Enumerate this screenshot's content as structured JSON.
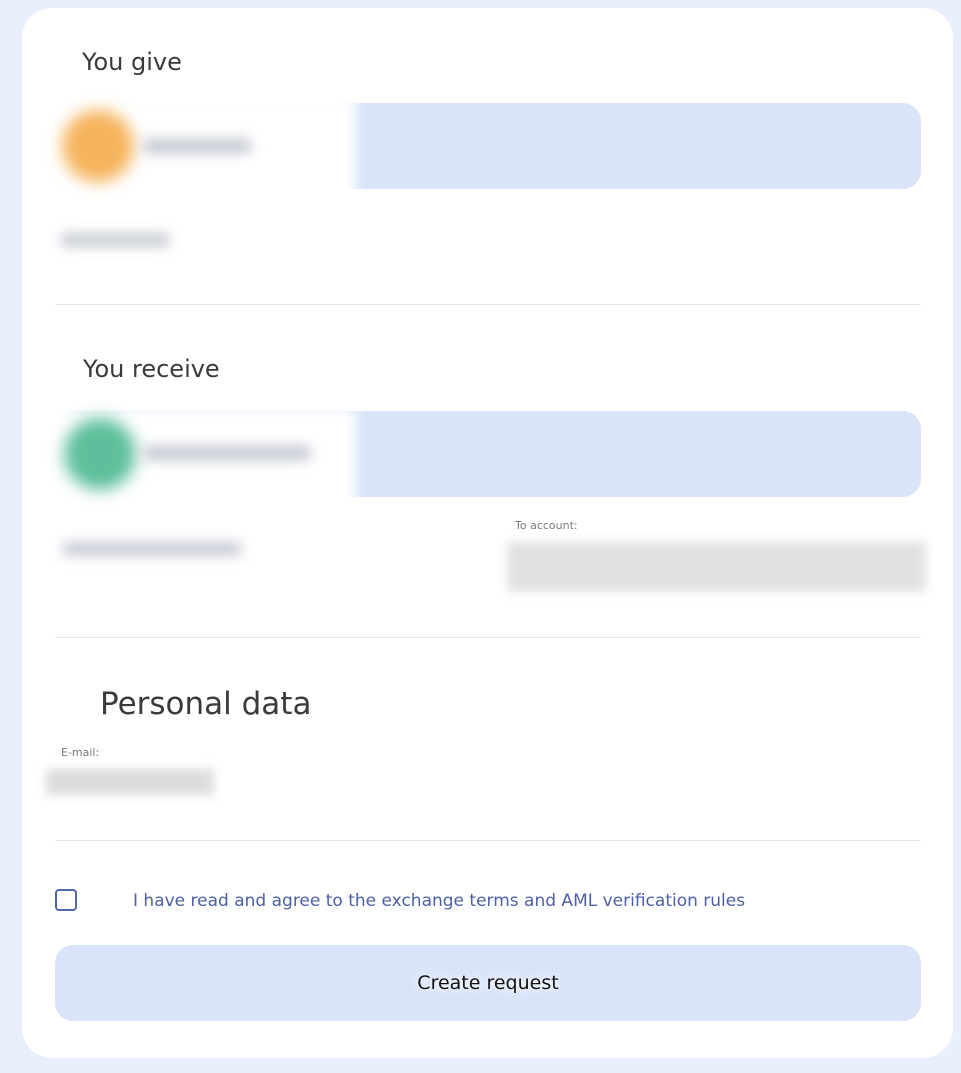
{
  "give": {
    "title": "You give"
  },
  "receive": {
    "title": "You receive",
    "to_account_label": "To account:"
  },
  "personal": {
    "title": "Personal data",
    "email_label": "E-mail:"
  },
  "terms": {
    "text": "I have read and agree to the exchange terms and AML verification rules"
  },
  "submit": {
    "label": "Create request"
  },
  "colors": {
    "page_background": "#e9effc",
    "card_background": "#ffffff",
    "select_background": "#d9e4fb",
    "terms_text": "#4d5fa6",
    "give_coin": "#f5b35c",
    "receive_coin": "#5dbf9b"
  }
}
